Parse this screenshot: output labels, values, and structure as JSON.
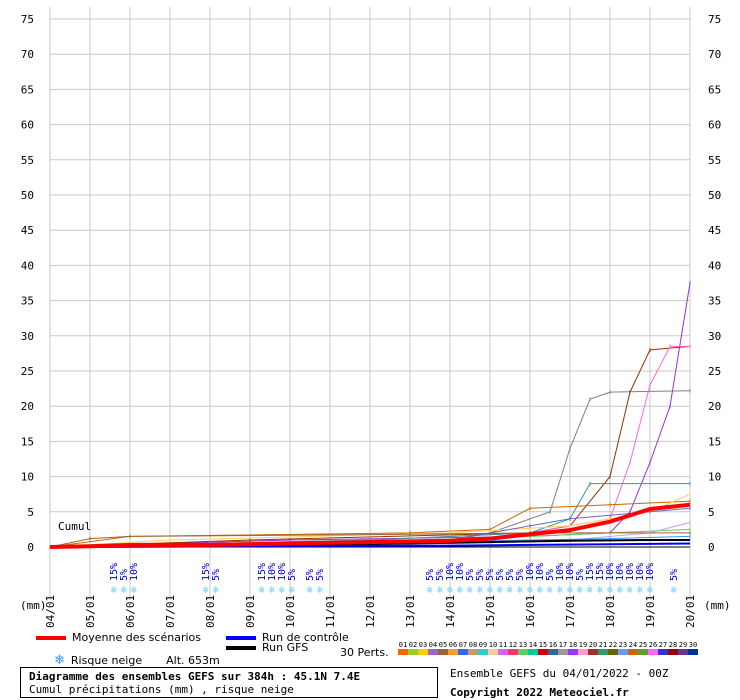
{
  "chart_data": {
    "type": "line",
    "title": "Diagramme des ensembles GEFS sur 384h : 45.1N 7.4E",
    "subtitle": "Cumul précipitations (mm) , risque neige",
    "xlabel": "",
    "ylabel": "(mm)",
    "ylim": [
      0,
      75
    ],
    "y_ticks": [
      0,
      5,
      10,
      15,
      20,
      25,
      30,
      35,
      40,
      45,
      50,
      55,
      60,
      65,
      70,
      75
    ],
    "x_ticks": [
      "04/01",
      "05/01",
      "06/01",
      "07/01",
      "08/01",
      "09/01",
      "10/01",
      "11/01",
      "12/01",
      "13/01",
      "14/01",
      "15/01",
      "16/01",
      "17/01",
      "18/01",
      "19/01",
      "20/01"
    ],
    "xlim_days": [
      0,
      16
    ],
    "grid": true,
    "plot_annotation": "Cumul",
    "mean_series": {
      "name": "Moyenne des scénarios",
      "color": "#ff0000",
      "points": [
        [
          0,
          0
        ],
        [
          1,
          0.1
        ],
        [
          2,
          0.3
        ],
        [
          3,
          0.3
        ],
        [
          4,
          0.3
        ],
        [
          5,
          0.4
        ],
        [
          6,
          0.5
        ],
        [
          7,
          0.6
        ],
        [
          8,
          0.7
        ],
        [
          9,
          0.8
        ],
        [
          10,
          0.9
        ],
        [
          11,
          1.2
        ],
        [
          12,
          1.8
        ],
        [
          13,
          2.4
        ],
        [
          14,
          3.6
        ],
        [
          15,
          5.4
        ],
        [
          16,
          6.0
        ]
      ]
    },
    "control_series": {
      "name": "Run de contrôle",
      "color": "#0000ff",
      "points": [
        [
          0,
          0
        ],
        [
          5,
          0.1
        ],
        [
          10,
          0.2
        ],
        [
          12,
          0.3
        ],
        [
          14,
          0.4
        ],
        [
          16,
          0.5
        ]
      ]
    },
    "gfs_series": {
      "name": "Run GFS",
      "color": "#000000",
      "points": [
        [
          0,
          0
        ],
        [
          5,
          0.2
        ],
        [
          9,
          0.5
        ],
        [
          11,
          0.7
        ],
        [
          13,
          0.9
        ],
        [
          15,
          1.0
        ],
        [
          16,
          1.0
        ]
      ]
    },
    "members": [
      {
        "color": "#808080",
        "points": [
          [
            0,
            0
          ],
          [
            5,
            0.5
          ],
          [
            10,
            1.0
          ],
          [
            11,
            2.0
          ],
          [
            12.5,
            5.0
          ],
          [
            13,
            14.0
          ],
          [
            13.5,
            21.0
          ],
          [
            14,
            22.0
          ],
          [
            16,
            22.2
          ]
        ]
      },
      {
        "color": "#9933cc",
        "points": [
          [
            0,
            0
          ],
          [
            6,
            1.0
          ],
          [
            12,
            1.5
          ],
          [
            14,
            2.0
          ],
          [
            14.5,
            5.0
          ],
          [
            15,
            12.0
          ],
          [
            15.5,
            20.0
          ],
          [
            16,
            37.5
          ]
        ]
      },
      {
        "color": "#993300",
        "points": [
          [
            0,
            0
          ],
          [
            5,
            1.0
          ],
          [
            12,
            2.0
          ],
          [
            13,
            3.0
          ],
          [
            14,
            10.0
          ],
          [
            14.5,
            22.0
          ],
          [
            15,
            28.0
          ],
          [
            16,
            28.5
          ]
        ]
      },
      {
        "color": "#ff66cc",
        "points": [
          [
            0,
            0
          ],
          [
            8,
            1.0
          ],
          [
            12,
            2.0
          ],
          [
            14,
            4.0
          ],
          [
            14.5,
            12.0
          ],
          [
            15,
            23.0
          ],
          [
            15.5,
            28.5
          ],
          [
            16,
            28.5
          ]
        ]
      },
      {
        "color": "#339999",
        "points": [
          [
            0,
            0
          ],
          [
            8,
            1.0
          ],
          [
            12,
            2.0
          ],
          [
            13,
            4.0
          ],
          [
            13.5,
            9.0
          ],
          [
            16,
            9.0
          ]
        ]
      },
      {
        "color": "#cc6600",
        "points": [
          [
            0,
            0
          ],
          [
            2,
            1.5
          ],
          [
            9,
            2.0
          ],
          [
            11,
            2.5
          ],
          [
            12,
            5.5
          ],
          [
            14,
            6.0
          ],
          [
            16,
            6.5
          ]
        ]
      },
      {
        "color": "#ffcc66",
        "points": [
          [
            0,
            0
          ],
          [
            3,
            1.0
          ],
          [
            10,
            2.0
          ],
          [
            13,
            3.0
          ],
          [
            15,
            5.0
          ],
          [
            16,
            7.5
          ]
        ]
      },
      {
        "color": "#6666cc",
        "points": [
          [
            0,
            0
          ],
          [
            6,
            0.5
          ],
          [
            10,
            1.0
          ],
          [
            12,
            3.0
          ],
          [
            13,
            4.0
          ],
          [
            15,
            5.0
          ],
          [
            16,
            5.5
          ]
        ]
      },
      {
        "color": "#66cc66",
        "points": [
          [
            0,
            0
          ],
          [
            4,
            0.5
          ],
          [
            10,
            1.0
          ],
          [
            14,
            2.0
          ],
          [
            16,
            2.5
          ]
        ]
      },
      {
        "color": "#cc99ff",
        "points": [
          [
            0,
            0
          ],
          [
            9,
            0.5
          ],
          [
            13,
            1.0
          ],
          [
            15,
            2.0
          ],
          [
            16,
            3.5
          ]
        ]
      },
      {
        "color": "#996633",
        "points": [
          [
            0,
            0
          ],
          [
            1,
            1.2
          ],
          [
            2,
            1.5
          ],
          [
            9,
            1.8
          ],
          [
            12,
            2.0
          ],
          [
            16,
            2.0
          ]
        ]
      },
      {
        "color": "#3399ff",
        "points": [
          [
            0,
            0
          ],
          [
            5,
            0.4
          ],
          [
            10,
            0.8
          ],
          [
            14,
            1.2
          ],
          [
            16,
            1.5
          ]
        ]
      }
    ],
    "snow_risk": [
      {
        "day": 1.6,
        "labels": [
          "15%",
          "5%",
          "10%"
        ]
      },
      {
        "day": 3.9,
        "labels": [
          "15%",
          "5%"
        ]
      },
      {
        "day": 5.3,
        "labels": [
          "15%",
          "10%",
          "10%",
          "5%"
        ]
      },
      {
        "day": 6.5,
        "labels": [
          "5%",
          "5%"
        ]
      },
      {
        "day": 9.5,
        "labels": [
          "5%",
          "5%",
          "10%",
          "10%",
          "5%",
          "5%",
          "5%",
          "5%",
          "5%",
          "5%",
          "10%",
          "10%",
          "5%",
          "10%",
          "10%",
          "5%",
          "15%",
          "15%",
          "10%",
          "10%",
          "10%",
          "10%",
          "10%"
        ]
      },
      {
        "day": 15.6,
        "labels": [
          "5%"
        ]
      }
    ]
  },
  "legend": {
    "mean": "Moyenne des scénarios",
    "control": "Run de contrôle",
    "gfs": "Run GFS",
    "snow": "Risque neige",
    "altitude": "Alt. 653m",
    "perts": "30 Perts."
  },
  "pert_labels": [
    "01",
    "02",
    "03",
    "04",
    "05",
    "06",
    "07",
    "08",
    "09",
    "10",
    "11",
    "12",
    "13",
    "14",
    "15",
    "16",
    "17",
    "18",
    "19",
    "20",
    "21",
    "22",
    "23",
    "24",
    "25",
    "26",
    "27",
    "28",
    "29",
    "30"
  ],
  "pert_colors": [
    "#ff6600",
    "#99cc33",
    "#ffcc00",
    "#9966cc",
    "#996633",
    "#ff9933",
    "#3366ff",
    "#cc9966",
    "#33cccc",
    "#ffcc99",
    "#cc66ff",
    "#ff3366",
    "#66cc66",
    "#00cc99",
    "#cc0000",
    "#336699",
    "#999999",
    "#9933ff",
    "#ff99cc",
    "#993333",
    "#339966",
    "#666600",
    "#6699ff",
    "#cc6600",
    "#669933",
    "#ff66ff",
    "#3333cc",
    "#990000",
    "#663399",
    "#003399"
  ],
  "info": {
    "title": "Diagramme des ensembles GEFS sur 384h : 45.1N 7.4E",
    "subtitle": "Cumul précipitations (mm) , risque neige"
  },
  "credit": {
    "run": "Ensemble GEFS du 04/01/2022 - 00Z",
    "copyright": "Copyright 2022 Meteociel.fr"
  }
}
